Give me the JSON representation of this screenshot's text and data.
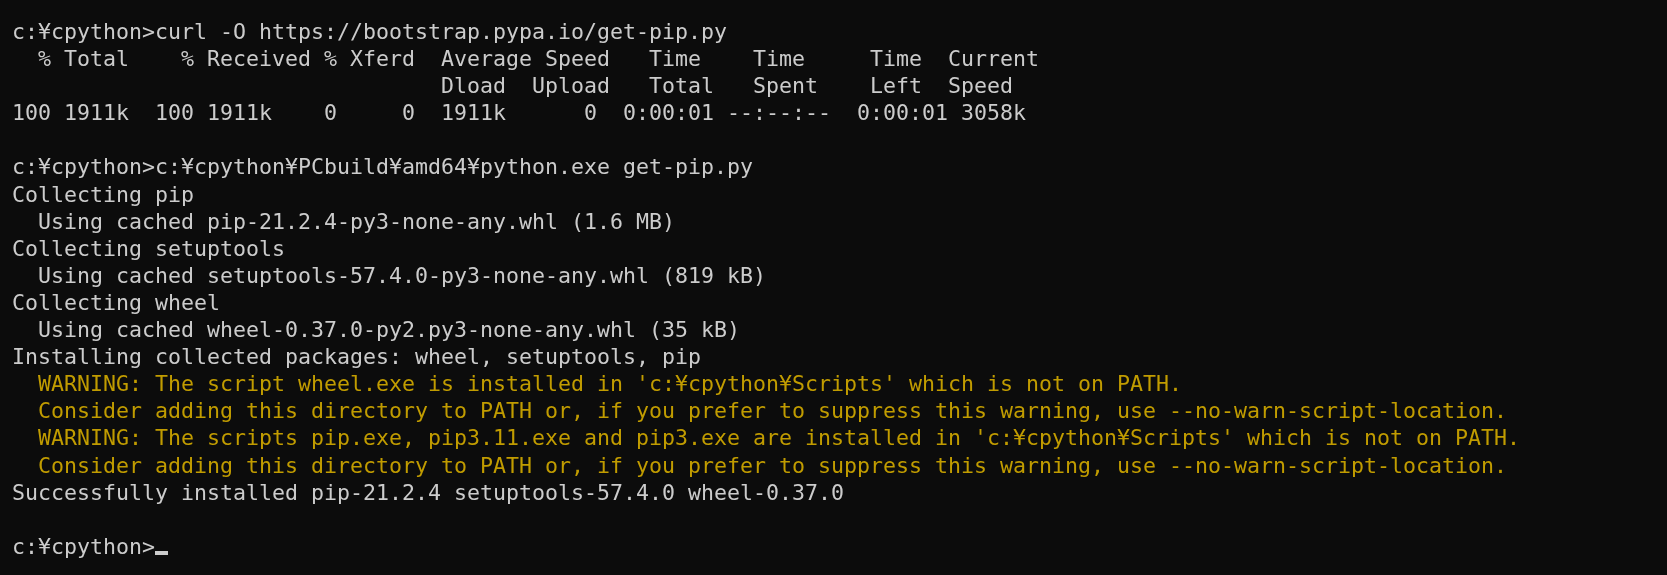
{
  "terminal": {
    "lines": [
      {
        "kind": "output",
        "text": "c:¥cpython>curl -O https://bootstrap.pypa.io/get-pip.py"
      },
      {
        "kind": "output",
        "text": "  % Total    % Received % Xferd  Average Speed   Time    Time     Time  Current"
      },
      {
        "kind": "output",
        "text": "                                 Dload  Upload   Total   Spent    Left  Speed"
      },
      {
        "kind": "output",
        "text": "100 1911k  100 1911k    0     0  1911k      0  0:00:01 --:--:--  0:00:01 3058k"
      },
      {
        "kind": "blank"
      },
      {
        "kind": "output",
        "text": "c:¥cpython>c:¥cpython¥PCbuild¥amd64¥python.exe get-pip.py"
      },
      {
        "kind": "output",
        "text": "Collecting pip"
      },
      {
        "kind": "output",
        "text": "  Using cached pip-21.2.4-py3-none-any.whl (1.6 MB)"
      },
      {
        "kind": "output",
        "text": "Collecting setuptools"
      },
      {
        "kind": "output",
        "text": "  Using cached setuptools-57.4.0-py3-none-any.whl (819 kB)"
      },
      {
        "kind": "output",
        "text": "Collecting wheel"
      },
      {
        "kind": "output",
        "text": "  Using cached wheel-0.37.0-py2.py3-none-any.whl (35 kB)"
      },
      {
        "kind": "output",
        "text": "Installing collected packages: wheel, setuptools, pip"
      },
      {
        "kind": "warning",
        "text": "  WARNING: The script wheel.exe is installed in 'c:¥cpython¥Scripts' which is not on PATH."
      },
      {
        "kind": "warning",
        "text": "  Consider adding this directory to PATH or, if you prefer to suppress this warning, use --no-warn-script-location."
      },
      {
        "kind": "warning",
        "text": "  WARNING: The scripts pip.exe, pip3.11.exe and pip3.exe are installed in 'c:¥cpython¥Scripts' which is not on PATH."
      },
      {
        "kind": "warning",
        "text": "  Consider adding this directory to PATH or, if you prefer to suppress this warning, use --no-warn-script-location."
      },
      {
        "kind": "output",
        "text": "Successfully installed pip-21.2.4 setuptools-57.4.0 wheel-0.37.0"
      },
      {
        "kind": "blank"
      }
    ],
    "prompt": {
      "text": "c:¥cpython>",
      "cursor": true
    }
  }
}
